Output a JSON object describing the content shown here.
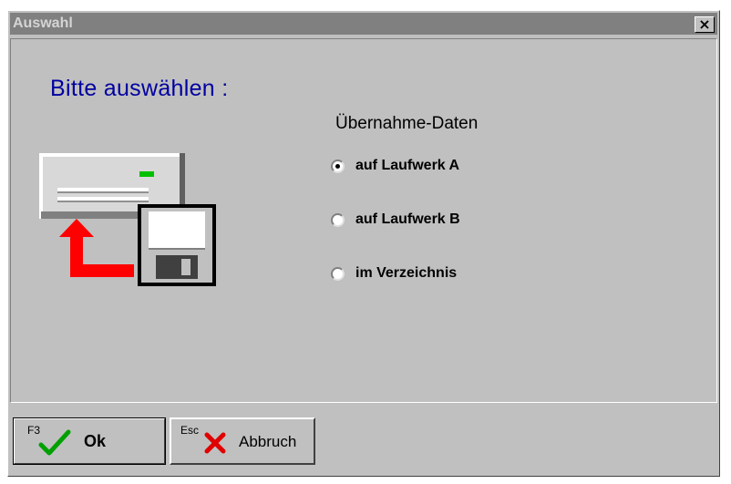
{
  "window": {
    "title": "Auswahl",
    "close_label": "×"
  },
  "prompt": "Bitte auswählen :",
  "group": {
    "title": "Übernahme-Daten",
    "options": [
      {
        "label": "auf Laufwerk A",
        "selected": true
      },
      {
        "label": "auf Laufwerk B",
        "selected": false
      },
      {
        "label": "im Verzeichnis",
        "selected": false
      }
    ]
  },
  "buttons": {
    "ok": {
      "key": "F3",
      "label": "Ok",
      "icon": "checkmark-icon"
    },
    "cancel": {
      "key": "Esc",
      "label": "Abbruch",
      "icon": "x-icon"
    }
  },
  "colors": {
    "titlebar": "#808080",
    "dialog": "#c0c0c0",
    "prompt": "#0000a0",
    "check": "#00a000",
    "cross": "#e00000"
  }
}
